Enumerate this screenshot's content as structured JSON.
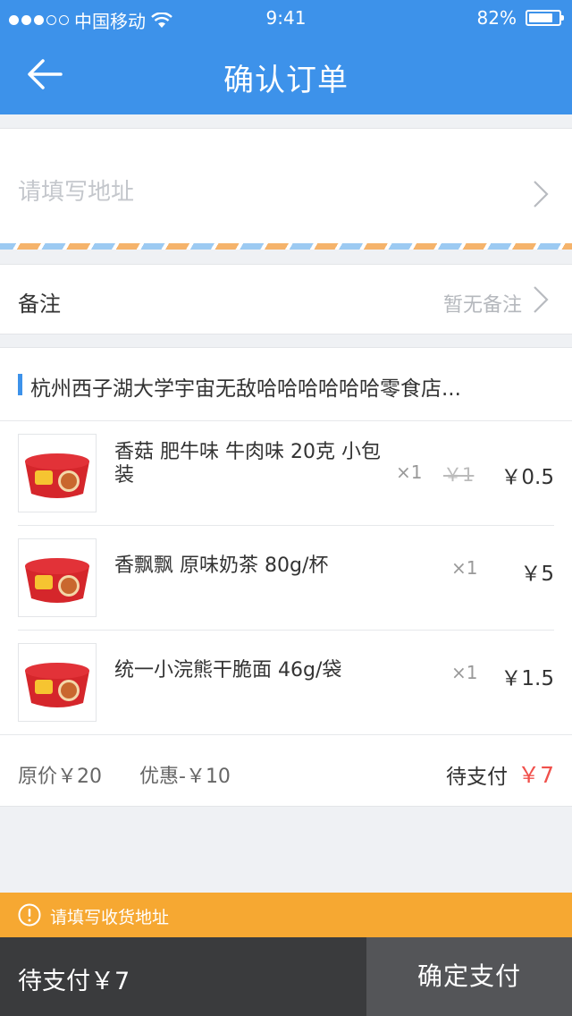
{
  "status_bar": {
    "carrier": "中国移动",
    "time": "9:41",
    "battery": "82%",
    "battery_level": 0.82
  },
  "nav": {
    "title": "确认订单",
    "back_icon": "arrow-left-icon"
  },
  "address": {
    "placeholder": "请填写地址"
  },
  "remark": {
    "label": "备注",
    "value": "暂无备注"
  },
  "store": {
    "name": "杭州西子湖大学宇宙无敌哈哈哈哈哈哈零食店..."
  },
  "items": [
    {
      "name": "香菇 肥牛味 牛肉味 20克 小包装",
      "qty": "×1",
      "old_price": "￥1",
      "price": "￥0.5"
    },
    {
      "name": "香飘飘 原味奶茶 80g/杯",
      "qty": "×1",
      "old_price": "",
      "price": "￥5"
    },
    {
      "name": "统一小浣熊干脆面 46g/袋",
      "qty": "×1",
      "old_price": "",
      "price": "￥1.5"
    }
  ],
  "summary": {
    "original": "原价￥20",
    "discount": "优惠-￥10",
    "pay_label": "待支付",
    "pay_value": "￥7"
  },
  "warning": {
    "text": "请填写收货地址"
  },
  "bottom": {
    "pay_text": "待支付￥7",
    "confirm_label": "确定支付"
  },
  "colors": {
    "header": "#3d92ea",
    "accent_red": "#f0504b",
    "warning": "#f6a832",
    "bottom_dark": "#3a3b3d",
    "confirm_button": "#545558"
  }
}
